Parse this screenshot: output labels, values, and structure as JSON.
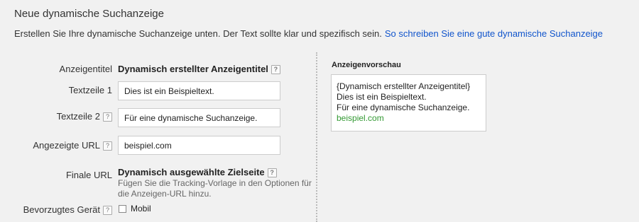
{
  "header": {
    "title": "Neue dynamische Suchanzeige",
    "intro_text": "Erstellen Sie Ihre dynamische Suchanzeige unten. Der Text sollte klar und spezifisch sein.",
    "intro_link": "So schreiben Sie eine gute dynamische Suchanzeige"
  },
  "form": {
    "ad_title_label": "Anzeigentitel",
    "ad_title_value": "Dynamisch erstellter Anzeigentitel",
    "line1_label": "Textzeile 1",
    "line1_value": "Dies ist ein Beispieltext.",
    "line2_label": "Textzeile 2",
    "line2_value": "Für eine dynamische Suchanzeige.",
    "display_url_label": "Angezeigte URL",
    "display_url_value": "beispiel.com",
    "final_url_label": "Finale URL",
    "final_url_value": "Dynamisch ausgewählte Zielseite",
    "final_url_hint": "Fügen Sie die Tracking-Vorlage in den Optionen für die Anzeigen-URL hinzu.",
    "device_label": "Bevorzugtes Gerät",
    "device_option": "Mobil",
    "device_checked": false,
    "help_icon": "?"
  },
  "preview": {
    "title": "Anzeigenvorschau",
    "headline": "{Dynamisch erstellter Anzeigentitel}",
    "line1": "Dies ist ein Beispieltext.",
    "line2": "Für eine dynamische Suchanzeige.",
    "url": "beispiel.com",
    "url_color": "#339933"
  },
  "colors": {
    "link": "#1155cc",
    "background": "#f1f1f1"
  }
}
